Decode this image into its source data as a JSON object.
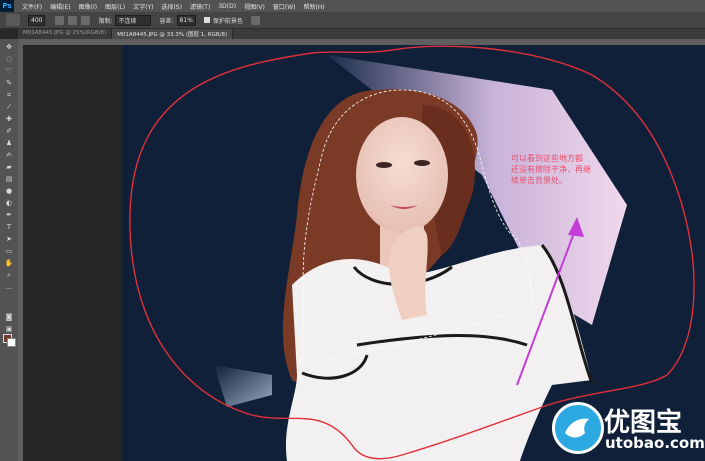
{
  "app": {
    "logo": "Ps"
  },
  "menu": [
    "文件(F)",
    "编辑(E)",
    "图像(I)",
    "图层(L)",
    "文字(Y)",
    "选择(S)",
    "滤镜(T)",
    "3D(D)",
    "视图(V)",
    "窗口(W)",
    "帮助(H)"
  ],
  "options": {
    "brush_size": "400",
    "limit_label": "限制:",
    "limit_value": "不连续",
    "tolerance_label": "容差:",
    "tolerance_value": "81%",
    "protect_label": "保护前景色"
  },
  "tabs": [
    {
      "label": "M01A8445.JPG @ 25%(RGB/8)",
      "active": false
    },
    {
      "label": "M01A8445.JPG @ 33.3% (图层 1, RGB/8)",
      "active": true
    }
  ],
  "annotation": [
    "可以看到这些地方都",
    "还没有擦除干净，再继",
    "续单击背景处。"
  ],
  "watermark": {
    "title": "优图宝",
    "url": "utobao.com"
  },
  "colors": {
    "canvas_bg": "#0f2038",
    "annotation": "#e8506c",
    "arrow": "#c23cd6",
    "outline": "#e0303a"
  }
}
